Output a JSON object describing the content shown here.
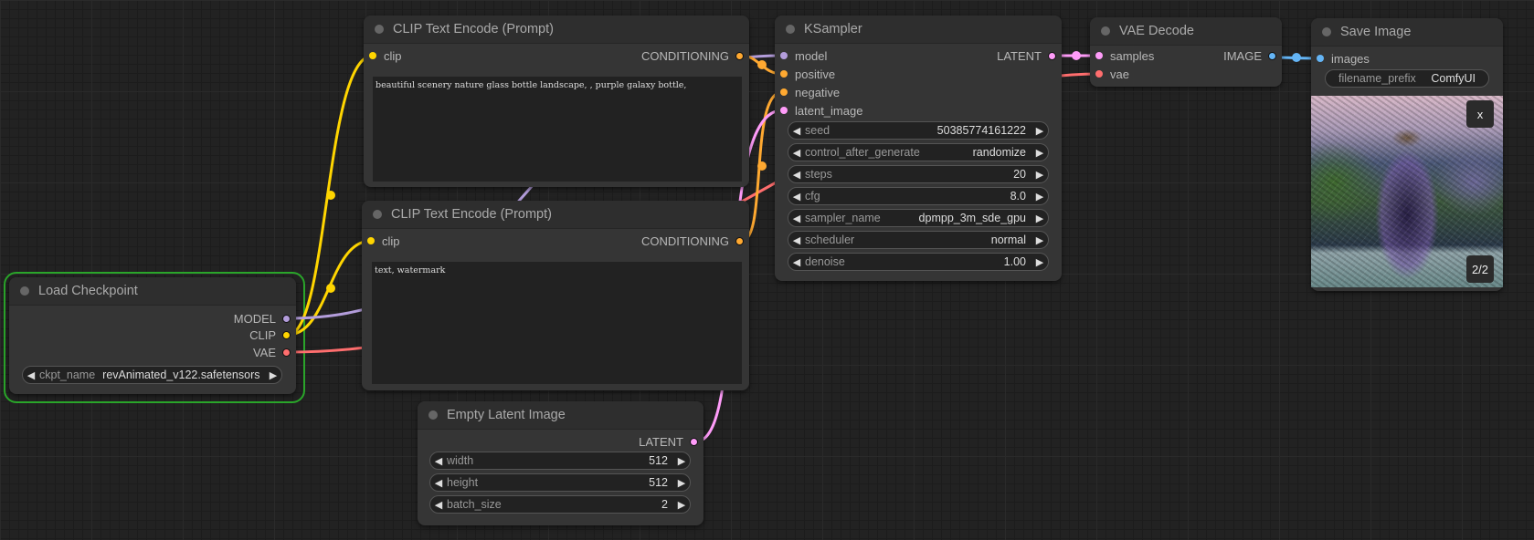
{
  "nodes": {
    "load_checkpoint": {
      "title": "Load Checkpoint",
      "outputs": [
        "MODEL",
        "CLIP",
        "VAE"
      ],
      "widget": {
        "label": "ckpt_name",
        "value": "revAnimated_v122.safetensors"
      }
    },
    "clip_positive": {
      "title": "CLIP Text Encode (Prompt)",
      "input": "clip",
      "output": "CONDITIONING",
      "text": "beautiful scenery nature glass bottle landscape, , purple galaxy bottle,"
    },
    "clip_negative": {
      "title": "CLIP Text Encode (Prompt)",
      "input": "clip",
      "output": "CONDITIONING",
      "text": "text, watermark"
    },
    "empty_latent": {
      "title": "Empty Latent Image",
      "output": "LATENT",
      "widgets": [
        {
          "label": "width",
          "value": "512"
        },
        {
          "label": "height",
          "value": "512"
        },
        {
          "label": "batch_size",
          "value": "2"
        }
      ]
    },
    "ksampler": {
      "title": "KSampler",
      "inputs": [
        "model",
        "positive",
        "negative",
        "latent_image"
      ],
      "output": "LATENT",
      "widgets": [
        {
          "label": "seed",
          "value": "50385774161222"
        },
        {
          "label": "control_after_generate",
          "value": "randomize"
        },
        {
          "label": "steps",
          "value": "20"
        },
        {
          "label": "cfg",
          "value": "8.0"
        },
        {
          "label": "sampler_name",
          "value": "dpmpp_3m_sde_gpu"
        },
        {
          "label": "scheduler",
          "value": "normal"
        },
        {
          "label": "denoise",
          "value": "1.00"
        }
      ]
    },
    "vae_decode": {
      "title": "VAE Decode",
      "inputs": [
        "samples",
        "vae"
      ],
      "output": "IMAGE"
    },
    "save_image": {
      "title": "Save Image",
      "input": "images",
      "widget": {
        "label": "filename_prefix",
        "value": "ComfyUI"
      },
      "preview": {
        "close_label": "x",
        "counter": "2/2",
        "description": "glass bottle with galaxy swirls in a mountain landscape"
      }
    }
  },
  "icons": {
    "left_arrow": "◀",
    "right_arrow": "▶"
  },
  "colors": {
    "model": "#b39ddb",
    "clip": "#ffd500",
    "vae": "#ff6e6e",
    "conditioning": "#ffa931",
    "latent": "#ff9cf9",
    "image": "#64b5f6",
    "group_border": "#2aa52a"
  }
}
